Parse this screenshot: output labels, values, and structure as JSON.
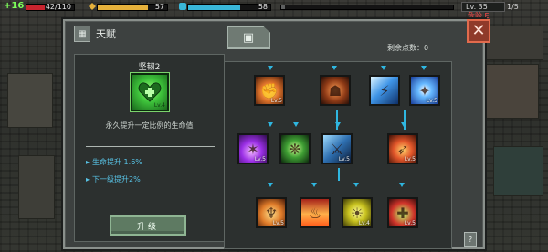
{
  "hud": {
    "hp_gain": "+16",
    "hp_value": "42/110",
    "hp_fraction": 0.38,
    "energy_value": "57",
    "energy_fraction": 0.73,
    "shield_value": "58",
    "shield_fraction": 0.63,
    "xp_fraction": 0.02,
    "level": "Lv. 35",
    "ratio": "1/5",
    "danger": "危险 E"
  },
  "window": {
    "title": "天赋",
    "points_label": "剩余点数：",
    "points_value": "0",
    "close_label": "✕",
    "tab_icon": "talent-tab-icon"
  },
  "detail": {
    "skill_name": "坚韧2",
    "skill_level": "Lv.4",
    "description": "永久提升一定比例的生命值",
    "stats": [
      {
        "label": "生命提升 1.6%"
      },
      {
        "label": "下一级提升2%"
      }
    ],
    "upgrade_label": "升级"
  },
  "tree": {
    "nodes": [
      {
        "id": "fist",
        "level": "Lv.5"
      },
      {
        "id": "hero",
        "level": ""
      },
      {
        "id": "bolt",
        "level": ""
      },
      {
        "id": "spark",
        "level": "Lv.5"
      },
      {
        "id": "purple",
        "level": "Lv.5"
      },
      {
        "id": "whirl",
        "level": ""
      },
      {
        "id": "swords",
        "level": "Lv.5"
      },
      {
        "id": "boot",
        "level": "Lv.5"
      },
      {
        "id": "man",
        "level": "Lv.5"
      },
      {
        "id": "fire",
        "level": ""
      },
      {
        "id": "glow",
        "level": "Lv.4"
      },
      {
        "id": "green",
        "level": "Lv.5"
      }
    ]
  },
  "colors": {
    "hp": "#c8242e",
    "energy": "#e6b13b",
    "shield": "#39b6d8",
    "accent_blue": "#2fb6e0",
    "close_red": "#8f3a2a"
  }
}
